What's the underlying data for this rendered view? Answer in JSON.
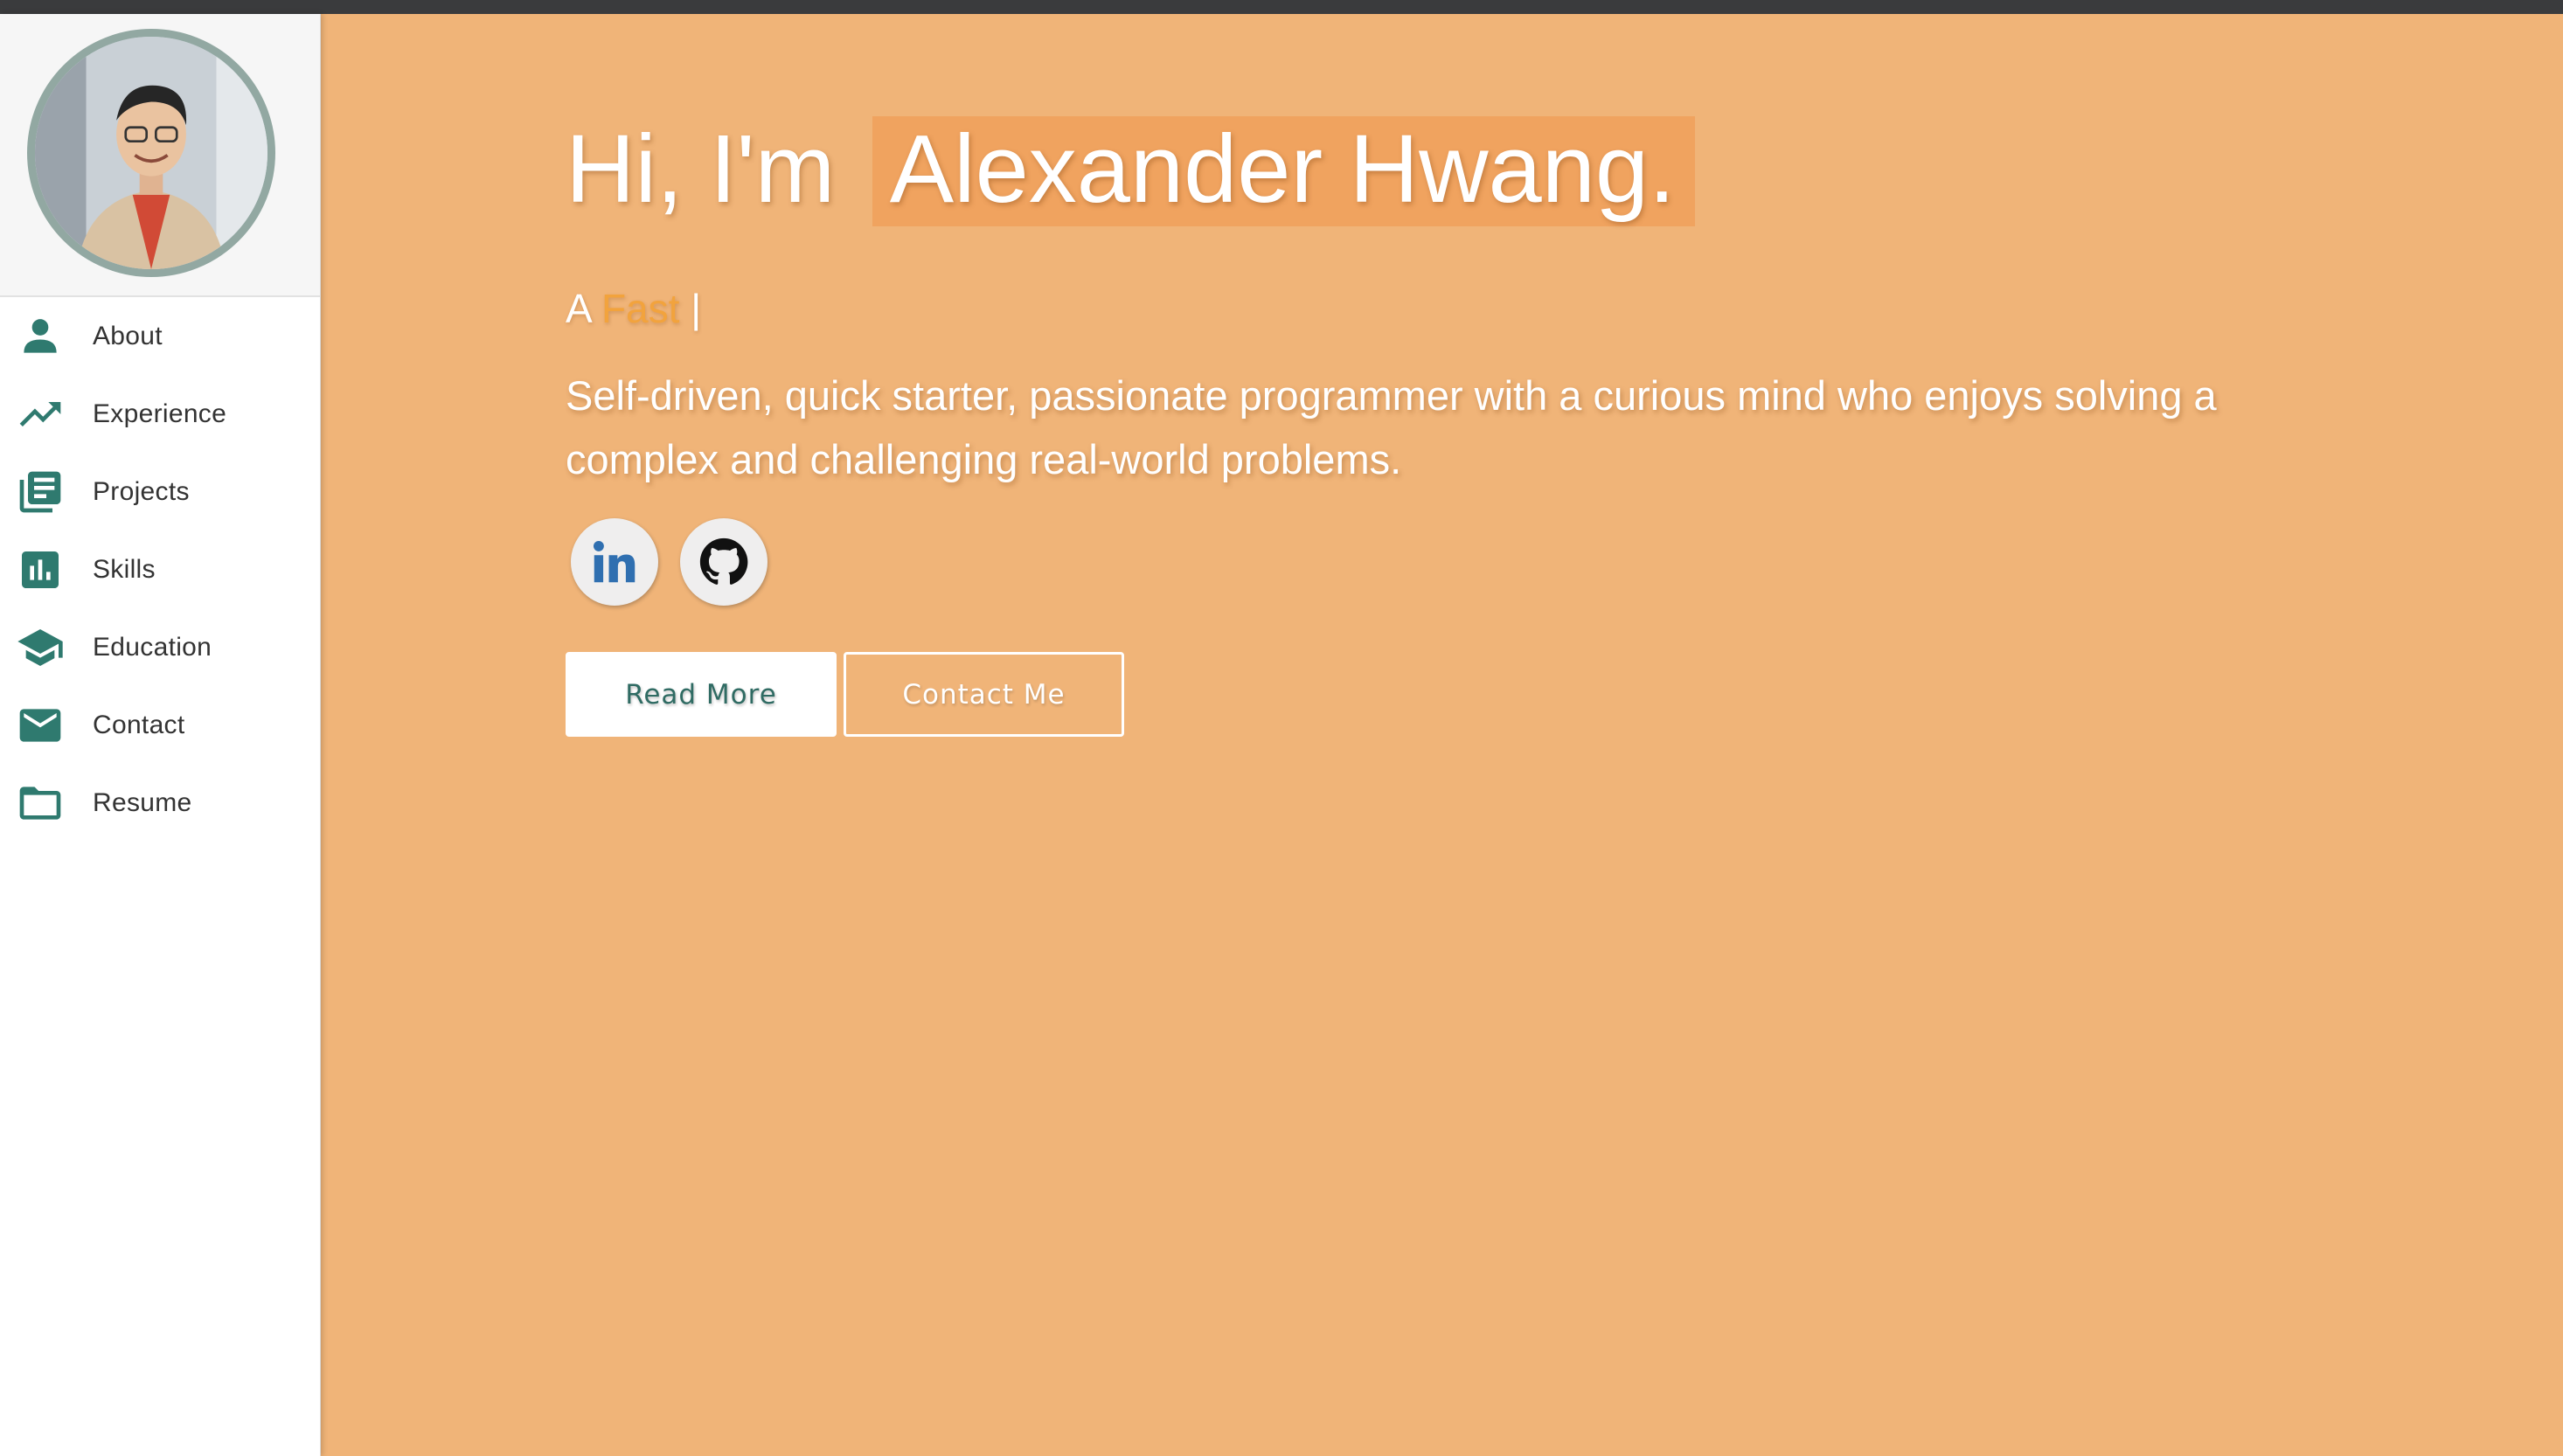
{
  "profile": {
    "avatar_icon": "profile-photo"
  },
  "sidebar": {
    "items": [
      {
        "label": "About",
        "icon": "person-icon"
      },
      {
        "label": "Experience",
        "icon": "trending-up-icon"
      },
      {
        "label": "Projects",
        "icon": "library-books-icon"
      },
      {
        "label": "Skills",
        "icon": "bar-chart-icon"
      },
      {
        "label": "Education",
        "icon": "graduation-cap-icon"
      },
      {
        "label": "Contact",
        "icon": "envelope-icon"
      },
      {
        "label": "Resume",
        "icon": "folder-icon"
      }
    ],
    "accent_color": "#2f7a6f"
  },
  "hero": {
    "greeting": "Hi, I'm",
    "name": "Alexander Hwang.",
    "typed_prefix": "A",
    "typed_word": "Fast",
    "typed_cursor": "|",
    "tagline": "Self-driven, quick starter, passionate programmer with a curious mind who enjoys solving a complex and challenging real-world problems.",
    "social": [
      {
        "icon": "linkedin-icon"
      },
      {
        "icon": "github-icon"
      }
    ],
    "primary_button": "Read More",
    "secondary_button": "Contact Me",
    "background_color": "#f0b478",
    "name_highlight_color": "#f0a35f",
    "typed_word_color": "#f2a33d"
  }
}
